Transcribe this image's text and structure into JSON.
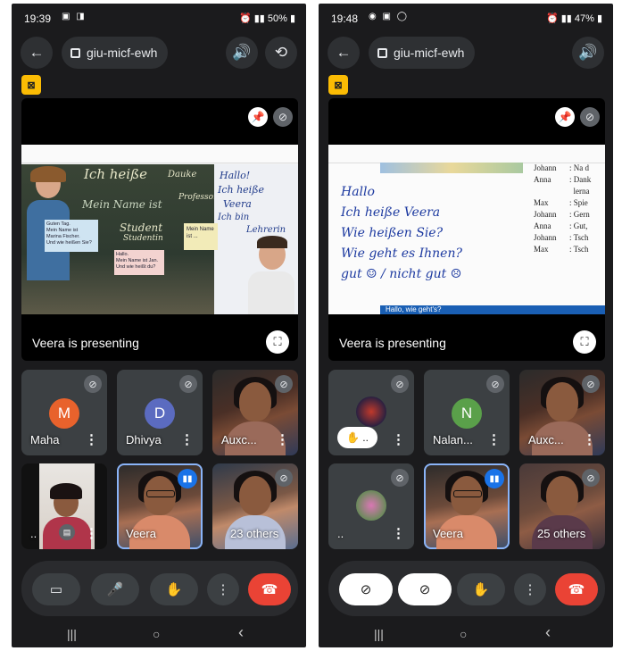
{
  "left": {
    "status": {
      "time": "19:39",
      "battery": "50%"
    },
    "meeting_code": "giu-micf-ewh",
    "presenting_text": "Veera is presenting",
    "slide": {
      "title": "Ich heiße",
      "board_words": [
        "Dauke",
        "Hallo!",
        "Ich heiße",
        "Veera",
        "Ich bin",
        "Lehrerin",
        "Mein Name ist",
        "Student",
        "Studentin",
        "Professor"
      ],
      "notes": [
        "Guten Tag.",
        "Mein Name ist",
        "Marina Fischer.",
        "Und wie heißen Sie?"
      ],
      "note2": [
        "Hallo.",
        "Mein Name ist Jan.",
        "Und wie heißt du?"
      ],
      "note3": [
        "Mein Name",
        "ist ..."
      ]
    },
    "participants": [
      {
        "name": "Maha",
        "initial": "M",
        "color": "#e8622c"
      },
      {
        "name": "Dhivya",
        "initial": "D",
        "color": "#5b6bc0"
      },
      {
        "name": "Auxc..."
      },
      {
        "name": ".."
      },
      {
        "name": "Veera"
      },
      {
        "name": "23 others"
      }
    ]
  },
  "right": {
    "status": {
      "time": "19:48",
      "battery": "47%"
    },
    "meeting_code": "giu-micf-ewh",
    "presenting_text": "Veera is presenting",
    "handwriting": [
      "Hallo",
      "Ich heiße Veera",
      "Wie heißen Sie?",
      "Wie geht es Ihnen?",
      "gut ☺ / nicht gut ☹"
    ],
    "dialogue": [
      {
        "speaker": "Johann",
        "text": "Na d"
      },
      {
        "speaker": "Anna",
        "text": "Dank"
      },
      {
        "speaker": "",
        "text": "lerna"
      },
      {
        "speaker": "Max",
        "text": "Spie"
      },
      {
        "speaker": "Johann",
        "text": "Gern"
      },
      {
        "speaker": "Anna",
        "text": "Gut,"
      },
      {
        "speaker": "Johann",
        "text": "Tsch"
      },
      {
        "speaker": "Max",
        "text": "Tsch"
      }
    ],
    "bottom_strip": "Hallo, wie geht's?",
    "participants": [
      {
        "name": ".."
      },
      {
        "name": "Nalan...",
        "initial": "N",
        "color": "#5aa04a"
      },
      {
        "name": "Auxc..."
      },
      {
        "name": ".."
      },
      {
        "name": "Veera"
      },
      {
        "name": "25 others"
      }
    ]
  },
  "icons": {
    "back": "←",
    "speaker": "🔊",
    "flip": "⟲",
    "pin": "📌",
    "mic_off": "🎙",
    "fullscreen": "⛶",
    "more": "⋮",
    "video": "▭",
    "video_off": "⊘",
    "mic": "🎤",
    "hand": "✋",
    "hangup": "☎",
    "nav_recent": "|||",
    "nav_home": "○",
    "nav_back": "‹"
  }
}
